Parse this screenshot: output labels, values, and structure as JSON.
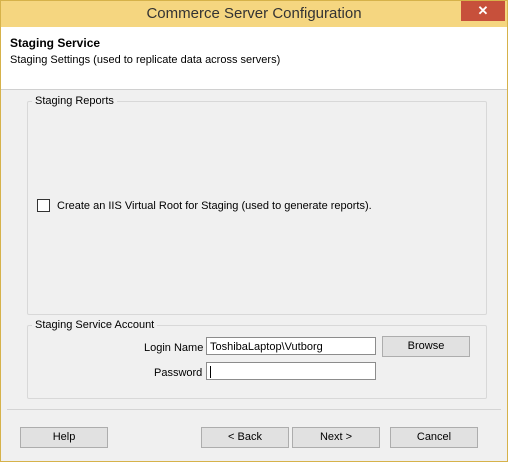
{
  "window": {
    "title": "Commerce Server Configuration",
    "close_glyph": "✕"
  },
  "header": {
    "title": "Staging Service",
    "subtitle": "Staging Settings (used to replicate data across servers)"
  },
  "staging_reports": {
    "legend": "Staging Reports",
    "checkbox_label": "Create an IIS Virtual Root for Staging (used to generate reports).",
    "checked": false
  },
  "account": {
    "legend": "Staging Service Account",
    "login_label": "Login Name",
    "login_value": "ToshibaLaptop\\Vutborg",
    "password_label": "Password",
    "password_value": "",
    "browse_label": "Browse"
  },
  "buttons": {
    "help": "Help",
    "back": "< Back",
    "next": "Next >",
    "cancel": "Cancel"
  }
}
